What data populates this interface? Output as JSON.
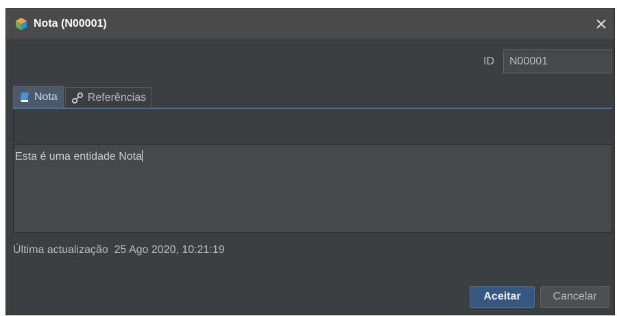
{
  "window": {
    "title": "Nota (N00001)",
    "icon": "app-gem-icon",
    "close_icon": "close-icon"
  },
  "header": {
    "id_label": "ID",
    "id_value": "N00001"
  },
  "tabs": [
    {
      "label": "Nota",
      "icon": "note-icon",
      "active": true
    },
    {
      "label": "Referências",
      "icon": "link-icon",
      "active": false
    }
  ],
  "editor": {
    "content": "Esta é uma entidade Nota"
  },
  "footer": {
    "last_update_label": "Última actualização",
    "last_update_value": "25 Ago 2020, 10:21:19",
    "accept_label": "Aceitar",
    "cancel_label": "Cancelar"
  },
  "colors": {
    "background": "#3c3f41",
    "titlebar": "#4a4a4a",
    "accent": "#365880",
    "text": "#bbbbbb"
  }
}
